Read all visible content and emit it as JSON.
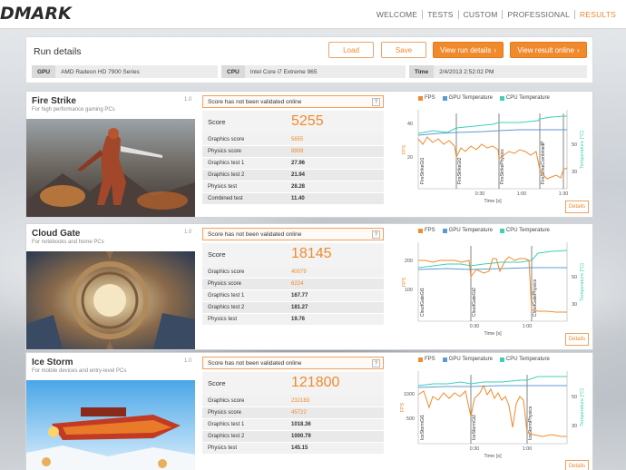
{
  "nav": {
    "logo": "DMARK",
    "items": [
      "WELCOME",
      "TESTS",
      "CUSTOM",
      "PROFESSIONAL",
      "RESULTS"
    ]
  },
  "run": {
    "title": "Run details",
    "load_label": "Load",
    "save_label": "Save",
    "view_run_label": "View run details",
    "view_online_label": "View result online",
    "gpu_key": "GPU",
    "gpu_value": "AMD Radeon HD 7900 Series",
    "cpu_key": "CPU",
    "cpu_value": "Intel Core i7 Extreme 965",
    "time_key": "Time",
    "time_value": "2/4/2013 2:52:02 PM"
  },
  "legend": {
    "fps": "FPS",
    "gpu": "GPU Temperature",
    "cpu": "CPU Temperature"
  },
  "colors": {
    "fps": "#f08a2c",
    "gpu": "#5b9bd5",
    "cpu": "#3fd0b5",
    "accent": "#f08a2c"
  },
  "benchmarks": [
    {
      "title": "Fire Strike",
      "subtitle": "For high performance gaming PCs",
      "version": "1.0",
      "notval": "Score has not been validated online",
      "score_label": "Score",
      "score": "5255",
      "rows": [
        {
          "k": "Graphics score",
          "v": "5655",
          "orange": true
        },
        {
          "k": "Physics score",
          "v": "8909",
          "orange": true
        },
        {
          "k": "Graphics test 1",
          "v": "27.96",
          "orange": false
        },
        {
          "k": "Graphics test 2",
          "v": "21.94",
          "orange": false
        },
        {
          "k": "Physics test",
          "v": "28.28",
          "orange": false
        },
        {
          "k": "Combined test",
          "v": "11.40",
          "orange": false
        }
      ],
      "yticks_left": [
        "40",
        "20"
      ],
      "yticks_right": [
        "50",
        "30"
      ],
      "xticks": [
        "0:30",
        "1:00",
        "1:30"
      ],
      "xlabel": "Time [s]",
      "ylabel_left": "FPS",
      "ylabel_right": "Temperature [°C]",
      "markers": [
        "FireStrikeGt1",
        "FireStrikeGt2",
        "FireStrikePhysics",
        "FireStrikeCombinedP"
      ],
      "details": "Details"
    },
    {
      "title": "Cloud Gate",
      "subtitle": "For notebooks and home PCs",
      "version": "1.0",
      "notval": "Score has not been validated online",
      "score_label": "Score",
      "score": "18145",
      "rows": [
        {
          "k": "Graphics score",
          "v": "40079",
          "orange": true
        },
        {
          "k": "Physics score",
          "v": "6224",
          "orange": true
        },
        {
          "k": "Graphics test 1",
          "v": "167.77",
          "orange": false
        },
        {
          "k": "Graphics test 2",
          "v": "181.27",
          "orange": false
        },
        {
          "k": "Physics test",
          "v": "19.76",
          "orange": false
        }
      ],
      "yticks_left": [
        "200",
        "100"
      ],
      "yticks_right": [
        "50",
        "30"
      ],
      "xticks": [
        "0:30",
        "1:00"
      ],
      "xlabel": "Time [s]",
      "ylabel_left": "FPS",
      "ylabel_right": "Temperature [°C]",
      "markers": [
        "CloudGateGt1",
        "CloudGateGt2",
        "CloudGatePhysics"
      ],
      "details": "Details"
    },
    {
      "title": "Ice Storm",
      "subtitle": "For mobile devices and entry-level PCs",
      "version": "1.0",
      "notval": "Score has not been validated online",
      "score_label": "Score",
      "score": "121800",
      "rows": [
        {
          "k": "Graphics score",
          "v": "232183",
          "orange": true
        },
        {
          "k": "Physics score",
          "v": "45722",
          "orange": true
        },
        {
          "k": "Graphics test 1",
          "v": "1018.36",
          "orange": false
        },
        {
          "k": "Graphics test 2",
          "v": "1000.79",
          "orange": false
        },
        {
          "k": "Physics test",
          "v": "145.15",
          "orange": false
        }
      ],
      "yticks_left": [
        "1000",
        "500"
      ],
      "yticks_right": [
        "50",
        "30"
      ],
      "xticks": [
        "0:30",
        "1:00"
      ],
      "xlabel": "Time [s]",
      "ylabel_left": "FPS",
      "ylabel_right": "Temperature [°C]",
      "markers": [
        "IceStormGt1",
        "IceStormGt2",
        "IceStormPhysics"
      ],
      "details": "Details"
    }
  ]
}
